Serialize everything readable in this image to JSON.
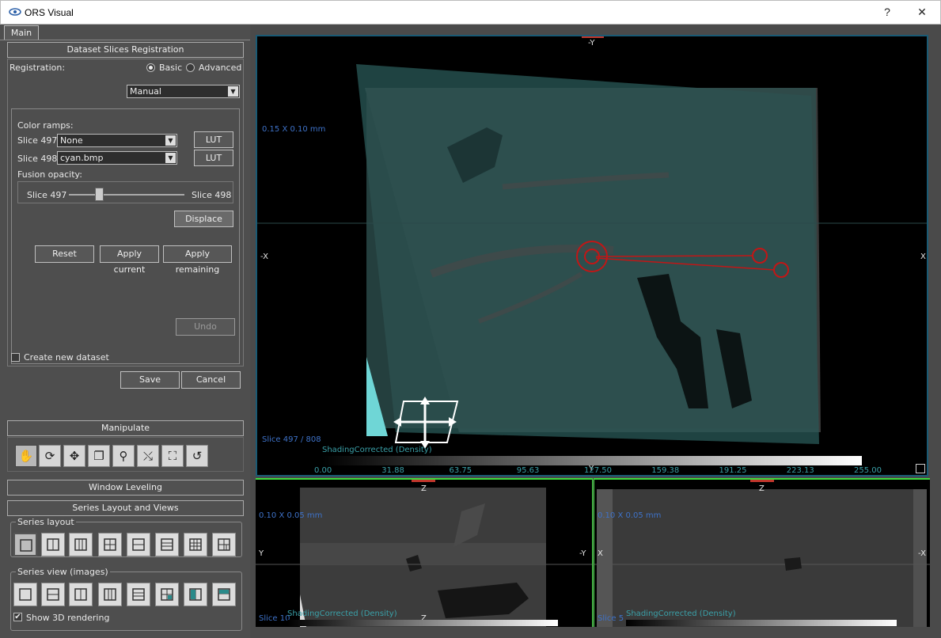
{
  "window": {
    "title": "ORS Visual",
    "help": "?",
    "close": "✕"
  },
  "tabs": {
    "main": "Main"
  },
  "registration": {
    "header": "Dataset Slices Registration",
    "label": "Registration:",
    "basic": "Basic",
    "advanced": "Advanced",
    "selected_mode": "Basic",
    "method_value": "Manual",
    "color_ramps_label": "Color ramps:",
    "slice_a_label": "Slice 497:",
    "slice_a_value": "None",
    "slice_b_label": "Slice 498:",
    "slice_b_value": "cyan.bmp",
    "lut": "LUT",
    "fusion_label": "Fusion opacity:",
    "fusion_left": "Slice 497",
    "fusion_right": "Slice 498",
    "fusion_value": 0.26,
    "displace": "Displace",
    "reset": "Reset",
    "apply_current": "Apply current",
    "apply_remaining": "Apply remaining",
    "undo": "Undo",
    "create_new_dataset": "Create new dataset",
    "create_new_checked": false,
    "save": "Save",
    "cancel": "Cancel"
  },
  "manipulate": {
    "header": "Manipulate",
    "tools": [
      "hand-icon",
      "rotate-icon",
      "pan-icon",
      "copy-icon",
      "zoom-icon",
      "cursor-icon",
      "fit-icon",
      "reset-icon"
    ]
  },
  "window_leveling": {
    "header": "Window Leveling"
  },
  "series": {
    "header": "Series Layout and Views",
    "layout_label": "Series layout",
    "view_label": "Series view (images)",
    "show_3d": "Show 3D rendering",
    "show_3d_checked": true
  },
  "main_view": {
    "top_axis": "-Y",
    "left_axis": "-X",
    "right_axis": "X",
    "bottom_axis": "Y",
    "scale": "0.15 X 0.10 mm",
    "slice": "Slice 497 / 808",
    "colorbar_label": "ShadingCorrected (Density)",
    "ticks": [
      "0.00",
      "31.88",
      "63.75",
      "95.63",
      "127.50",
      "159.38",
      "191.25",
      "223.13",
      "255.00"
    ]
  },
  "view_left": {
    "top_axis": "Z",
    "left_axis": "Y",
    "right_axis": "-Y",
    "bottom_axis": "Z",
    "scale": "0.10 X 0.05 mm",
    "slice": "Slice 10",
    "colorbar_label": "ShadingCorrected (Density)"
  },
  "view_right": {
    "top_axis": "Z",
    "left_axis": "X",
    "right_axis": "-X",
    "scale": "0.10 X 0.05 mm",
    "slice": "Slice 5",
    "colorbar_label": "ShadingCorrected (Density)"
  },
  "colors": {
    "accent_border": "#1a5a74",
    "orient_marker": "#c0362c",
    "active_view": "#3ddc3d"
  }
}
